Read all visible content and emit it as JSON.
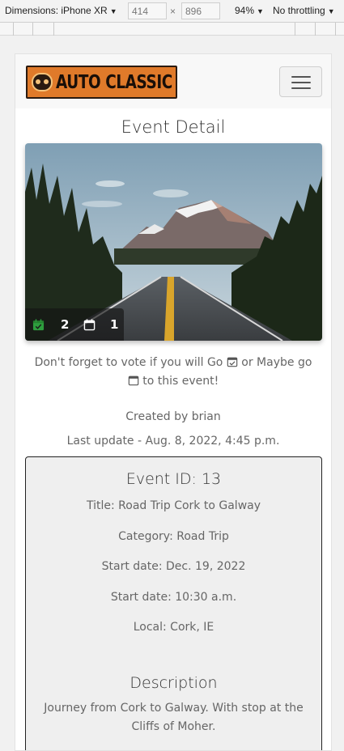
{
  "devtools": {
    "dimensions_label": "Dimensions: iPhone XR",
    "width": "414",
    "height": "896",
    "times": "×",
    "zoom": "94%",
    "throttling": "No throttling"
  },
  "brand": {
    "logo_text": "AUTO CLASSIC",
    "logo_color": "#e07a2a",
    "menu_icon": "hamburger-icon"
  },
  "page": {
    "title": "Event Detail"
  },
  "event_image": {
    "alt": "Road through mountains",
    "going_icon": "calendar-check-icon",
    "going_count": "2",
    "going_color": "#2e9e3e",
    "maybe_icon": "calendar-icon",
    "maybe_count": "1"
  },
  "note": {
    "part1": "Don't forget to vote if you will Go",
    "part2": "or Maybe go",
    "part3": "to this event!"
  },
  "meta": {
    "created_by": "Created by brian",
    "last_update": "Last update - Aug. 8, 2022, 4:45 p.m."
  },
  "details": {
    "event_id": "Event ID: 13",
    "title": "Title: Road Trip Cork to Galway",
    "category": "Category: Road Trip",
    "start_date": "Start date: Dec. 19, 2022",
    "start_time": "Start date: 10:30 a.m.",
    "local": "Local: Cork, IE",
    "description_heading": "Description",
    "description": "Journey from Cork to Galway. With stop at the Cliffs of Moher."
  }
}
